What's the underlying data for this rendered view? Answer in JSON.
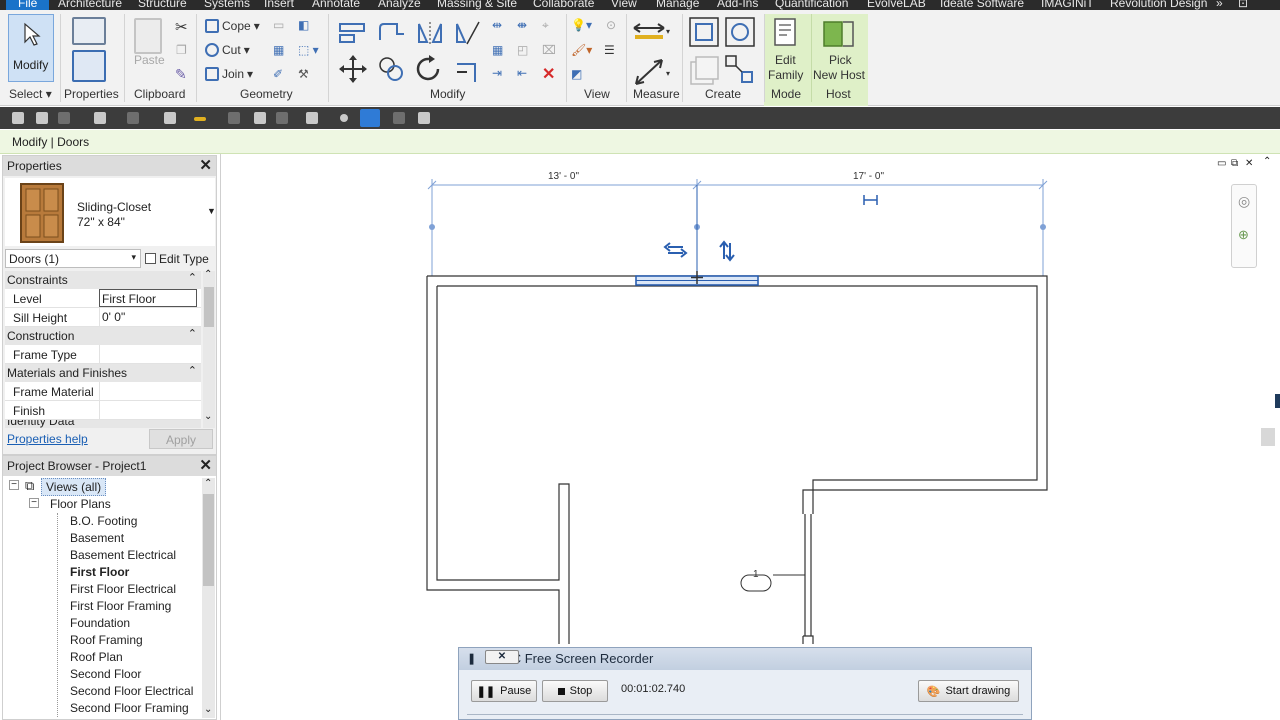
{
  "menu": {
    "file": "File",
    "tabs": [
      "Architecture",
      "Structure",
      "Systems",
      "Insert",
      "Annotate",
      "Analyze",
      "Massing & Site",
      "Collaborate",
      "View",
      "Manage",
      "Add-Ins",
      "Quantification",
      "EvolveLAB",
      "Ideate Software",
      "IMAGINiT",
      "Revolution Design"
    ]
  },
  "ribbon": {
    "select": {
      "modify": "Modify",
      "select": "Select"
    },
    "properties": {
      "label": "Properties"
    },
    "clipboard": {
      "paste": "Paste",
      "label": "Clipboard"
    },
    "geometry": {
      "cope": "Cope",
      "cut": "Cut",
      "join": "Join",
      "label": "Geometry"
    },
    "modify": {
      "label": "Modify"
    },
    "view": {
      "label": "View"
    },
    "measure": {
      "label": "Measure"
    },
    "create": {
      "label": "Create"
    },
    "mode": {
      "edit_family_line1": "Edit",
      "edit_family_line2": "Family",
      "label": "Mode"
    },
    "host": {
      "pick_line1": "Pick",
      "pick_line2": "New Host",
      "label": "Host"
    }
  },
  "context_bar": "Modify | Doors",
  "properties": {
    "title": "Properties",
    "type_name": "Sliding-Closet",
    "type_size": "72\" x 84\"",
    "selector": "Doors (1)",
    "edit_type": "Edit Type",
    "groups": {
      "constraints": "Constraints",
      "construction": "Construction",
      "materials": "Materials and Finishes",
      "identity": "Identity Data"
    },
    "params": {
      "level_key": "Level",
      "level_val": "First Floor",
      "sill_key": "Sill Height",
      "sill_val": "0'  0\"",
      "frame_type": "Frame Type",
      "frame_material": "Frame Material",
      "finish": "Finish"
    },
    "help": "Properties help",
    "apply": "Apply"
  },
  "browser": {
    "title": "Project Browser - Project1",
    "views_all": "Views (all)",
    "floor_plans": "Floor Plans",
    "items": [
      "B.O. Footing",
      "Basement",
      "Basement Electrical",
      "First Floor",
      "First Floor Electrical",
      "First Floor Framing",
      "Foundation",
      "Roof Framing",
      "Roof Plan",
      "Second Floor",
      "Second Floor Electrical",
      "Second Floor Framing"
    ],
    "active": "First Floor"
  },
  "canvas": {
    "dim_left": "13' - 0\"",
    "dim_right": "17' - 0\"",
    "tag": "1"
  },
  "recorder": {
    "title": "VSDC Free Screen Recorder",
    "pause": "Pause",
    "stop": "Stop",
    "time": "00:01:02.740",
    "start_drawing": "Start drawing"
  },
  "colors": {
    "file_tab": "#1a73c9",
    "selection_blue": "#2a5fb0",
    "context_green": "#eef7e2"
  }
}
